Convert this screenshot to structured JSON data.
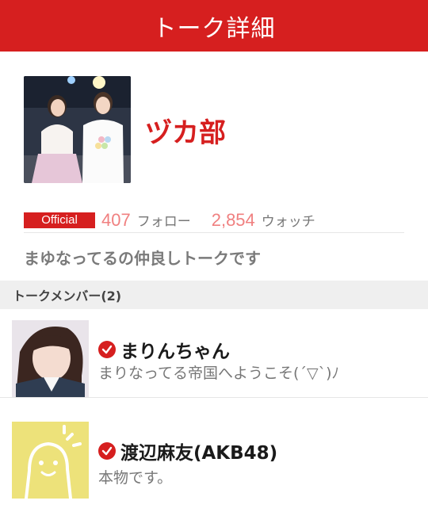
{
  "header": {
    "title": "トーク詳細"
  },
  "talk": {
    "name": "ヅカ部",
    "badge": "Official",
    "follow_count": "407",
    "follow_label": "フォロー",
    "watch_count": "2,854",
    "watch_label": "ウォッチ",
    "description": "まゆなってるの仲良しトークです"
  },
  "members_section": {
    "title": "トークメンバー(2)"
  },
  "members": [
    {
      "name": "まりんちゃん",
      "bio": "まりなってる帝国へようこそ(´▽`)ﾉ"
    },
    {
      "name": "渡辺麻友(AKB48)",
      "bio": "本物です。"
    }
  ],
  "colors": {
    "accent": "#d61f1f",
    "count": "#f08080"
  }
}
